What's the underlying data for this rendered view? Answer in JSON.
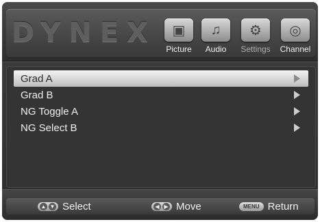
{
  "header": {
    "logo_text": "DYNEX",
    "tabs": [
      {
        "label": "Picture",
        "icon": "picture-icon"
      },
      {
        "label": "Audio",
        "icon": "audio-icon"
      },
      {
        "label": "Settings",
        "icon": "settings-icon"
      },
      {
        "label": "Channel",
        "icon": "channel-icon"
      }
    ]
  },
  "menu": {
    "items": [
      {
        "label": "Grad A",
        "selected": true
      },
      {
        "label": "Grad B"
      },
      {
        "label": "NG Toggle A"
      },
      {
        "label": "NG Select B"
      }
    ]
  },
  "footer": {
    "select_label": "Select",
    "move_label": "Move",
    "menu_key": "MENU",
    "return_label": "Return"
  }
}
